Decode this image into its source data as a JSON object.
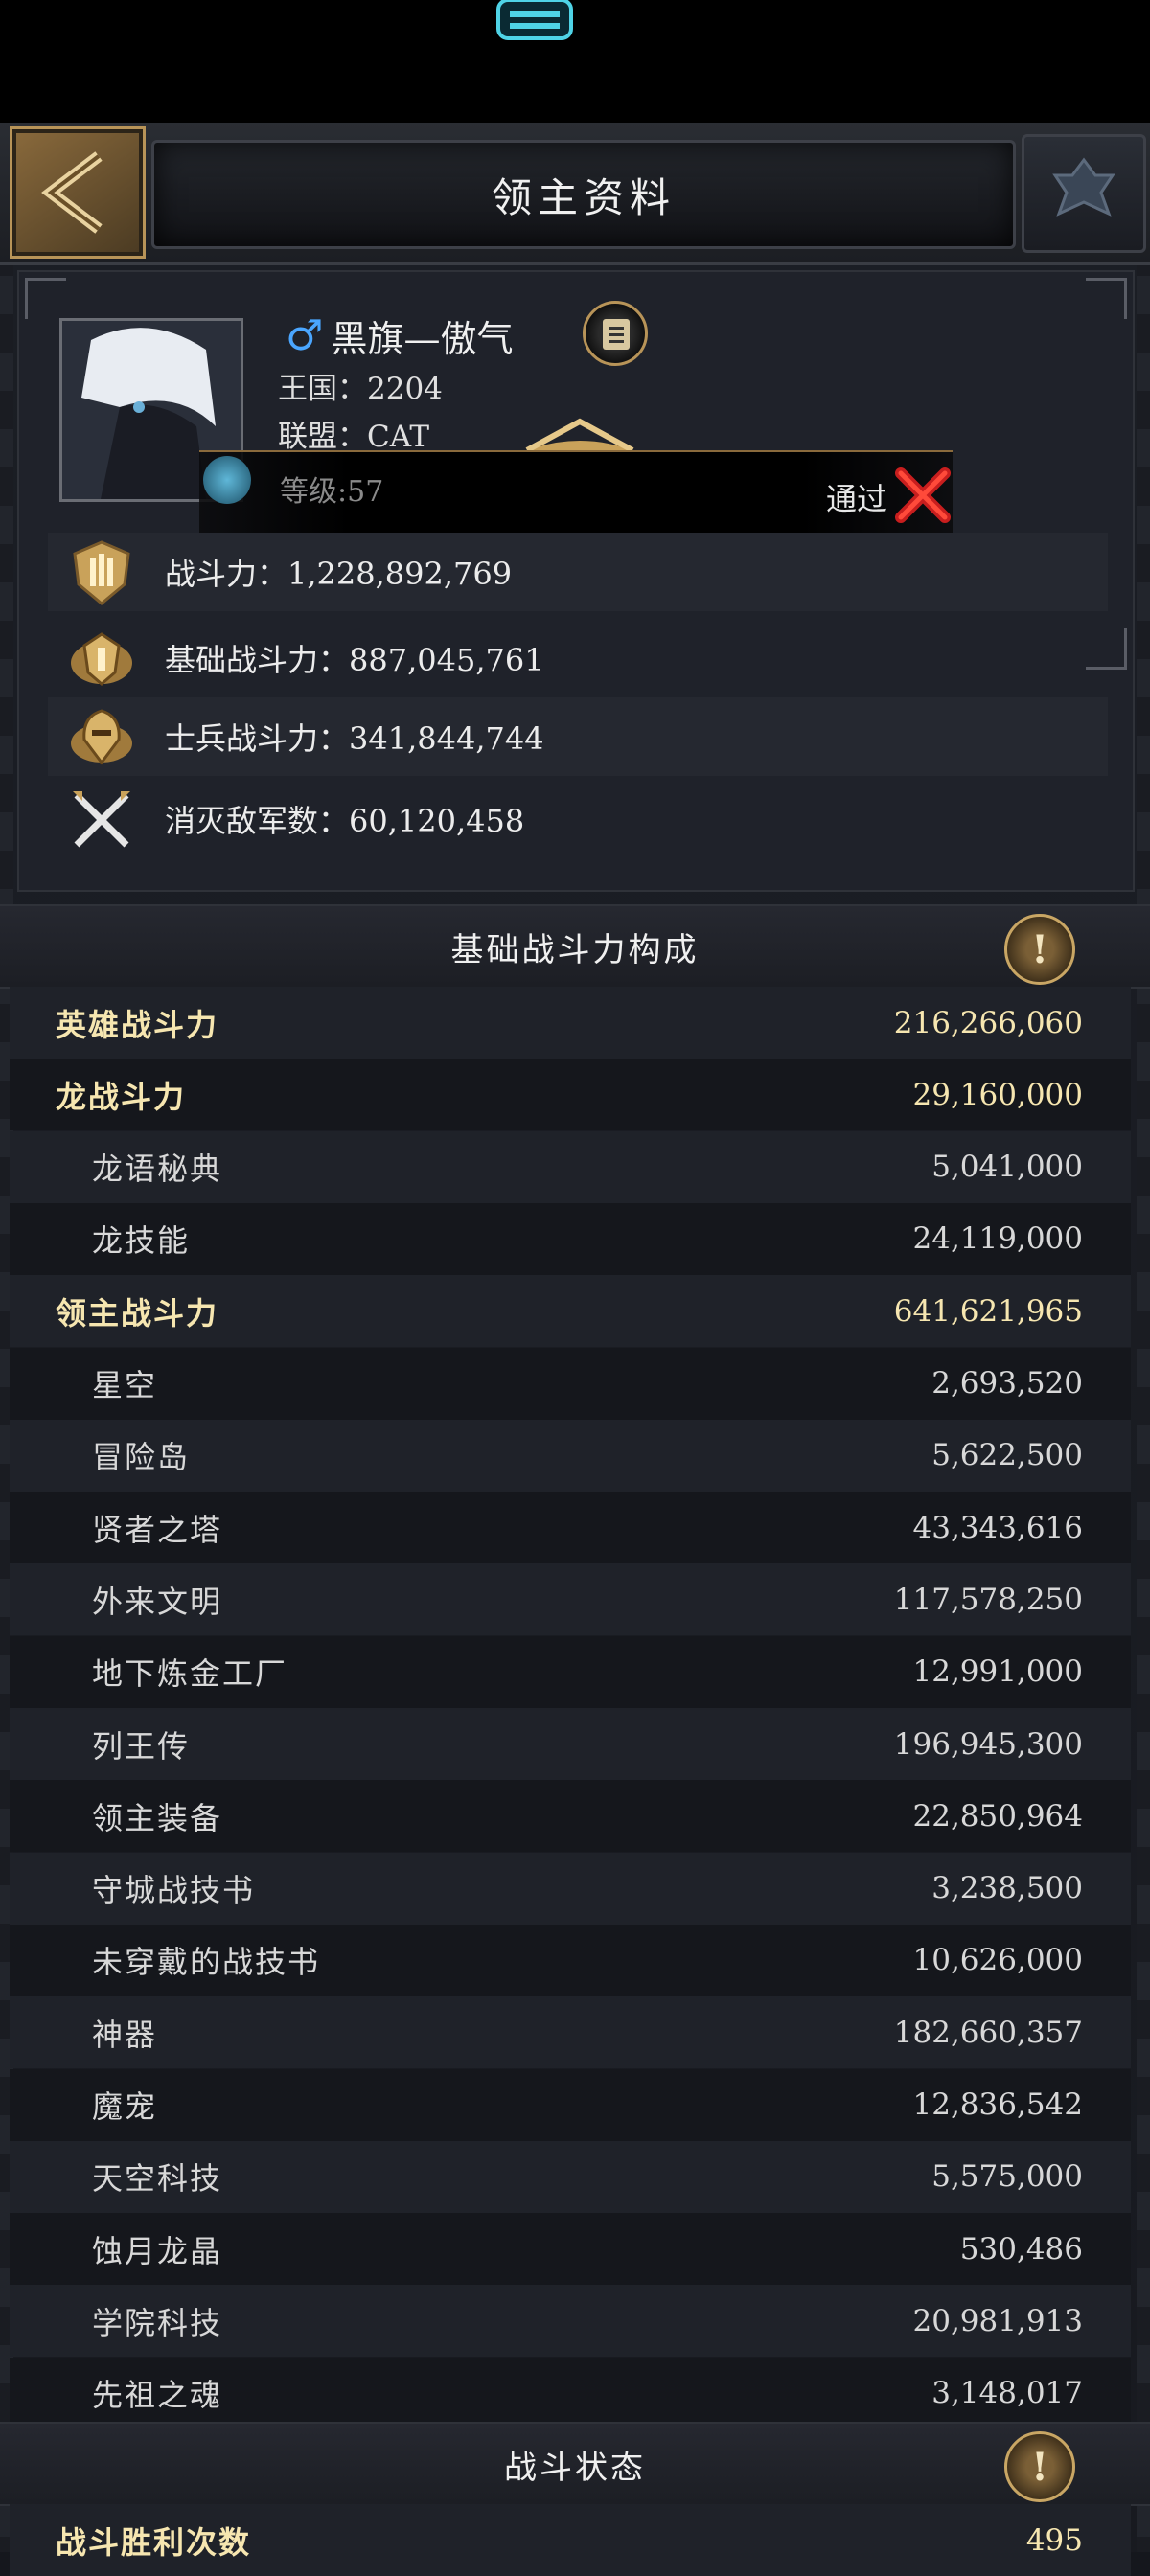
{
  "header": {
    "title": "领主资料"
  },
  "profile": {
    "gender_icon": "male-icon",
    "name": "黑旗—傲气",
    "kingdom": "王国：2204",
    "alliance": "联盟：CAT"
  },
  "toast": {
    "level": "等级:57",
    "pass": "通过"
  },
  "stats": [
    {
      "icon": "power-shield-icon",
      "label": "战斗力：1,228,892,769"
    },
    {
      "icon": "base-power-icon",
      "label": "基础战斗力：887,045,761"
    },
    {
      "icon": "troop-power-icon",
      "label": "士兵战斗力：341,844,744"
    },
    {
      "icon": "crossed-swords-icon",
      "label": "消灭敌军数：60,120,458"
    }
  ],
  "section_base": {
    "title": "基础战斗力构成",
    "tip_glyph": "!"
  },
  "rows": [
    {
      "label": "英雄战斗力",
      "value": "216,266,060",
      "level": "main"
    },
    {
      "label": "龙战斗力",
      "value": "29,160,000",
      "level": "main"
    },
    {
      "label": "龙语秘典",
      "value": "5,041,000",
      "level": "sub"
    },
    {
      "label": "龙技能",
      "value": "24,119,000",
      "level": "sub"
    },
    {
      "label": "领主战斗力",
      "value": "641,621,965",
      "level": "main"
    },
    {
      "label": "星空",
      "value": "2,693,520",
      "level": "sub"
    },
    {
      "label": "冒险岛",
      "value": "5,622,500",
      "level": "sub"
    },
    {
      "label": "贤者之塔",
      "value": "43,343,616",
      "level": "sub"
    },
    {
      "label": "外来文明",
      "value": "117,578,250",
      "level": "sub"
    },
    {
      "label": "地下炼金工厂",
      "value": "12,991,000",
      "level": "sub"
    },
    {
      "label": "列王传",
      "value": "196,945,300",
      "level": "sub"
    },
    {
      "label": "领主装备",
      "value": "22,850,964",
      "level": "sub"
    },
    {
      "label": "守城战技书",
      "value": "3,238,500",
      "level": "sub"
    },
    {
      "label": "未穿戴的战技书",
      "value": "10,626,000",
      "level": "sub"
    },
    {
      "label": "神器",
      "value": "182,660,357",
      "level": "sub"
    },
    {
      "label": "魔宠",
      "value": "12,836,542",
      "level": "sub"
    },
    {
      "label": "天空科技",
      "value": "5,575,000",
      "level": "sub"
    },
    {
      "label": "蚀月龙晶",
      "value": "530,486",
      "level": "sub"
    },
    {
      "label": "学院科技",
      "value": "20,981,913",
      "level": "sub"
    },
    {
      "label": "先祖之魂",
      "value": "3,148,017",
      "level": "sub"
    }
  ],
  "section_battle": {
    "title": "战斗状态",
    "tip_glyph": "!"
  },
  "battle_rows": [
    {
      "label": "战斗胜利次数",
      "value": "495",
      "level": "main"
    }
  ],
  "colors": {
    "gold_text": "#f6e6b0",
    "frame_gold": "#b89458",
    "background": "#15171d"
  }
}
